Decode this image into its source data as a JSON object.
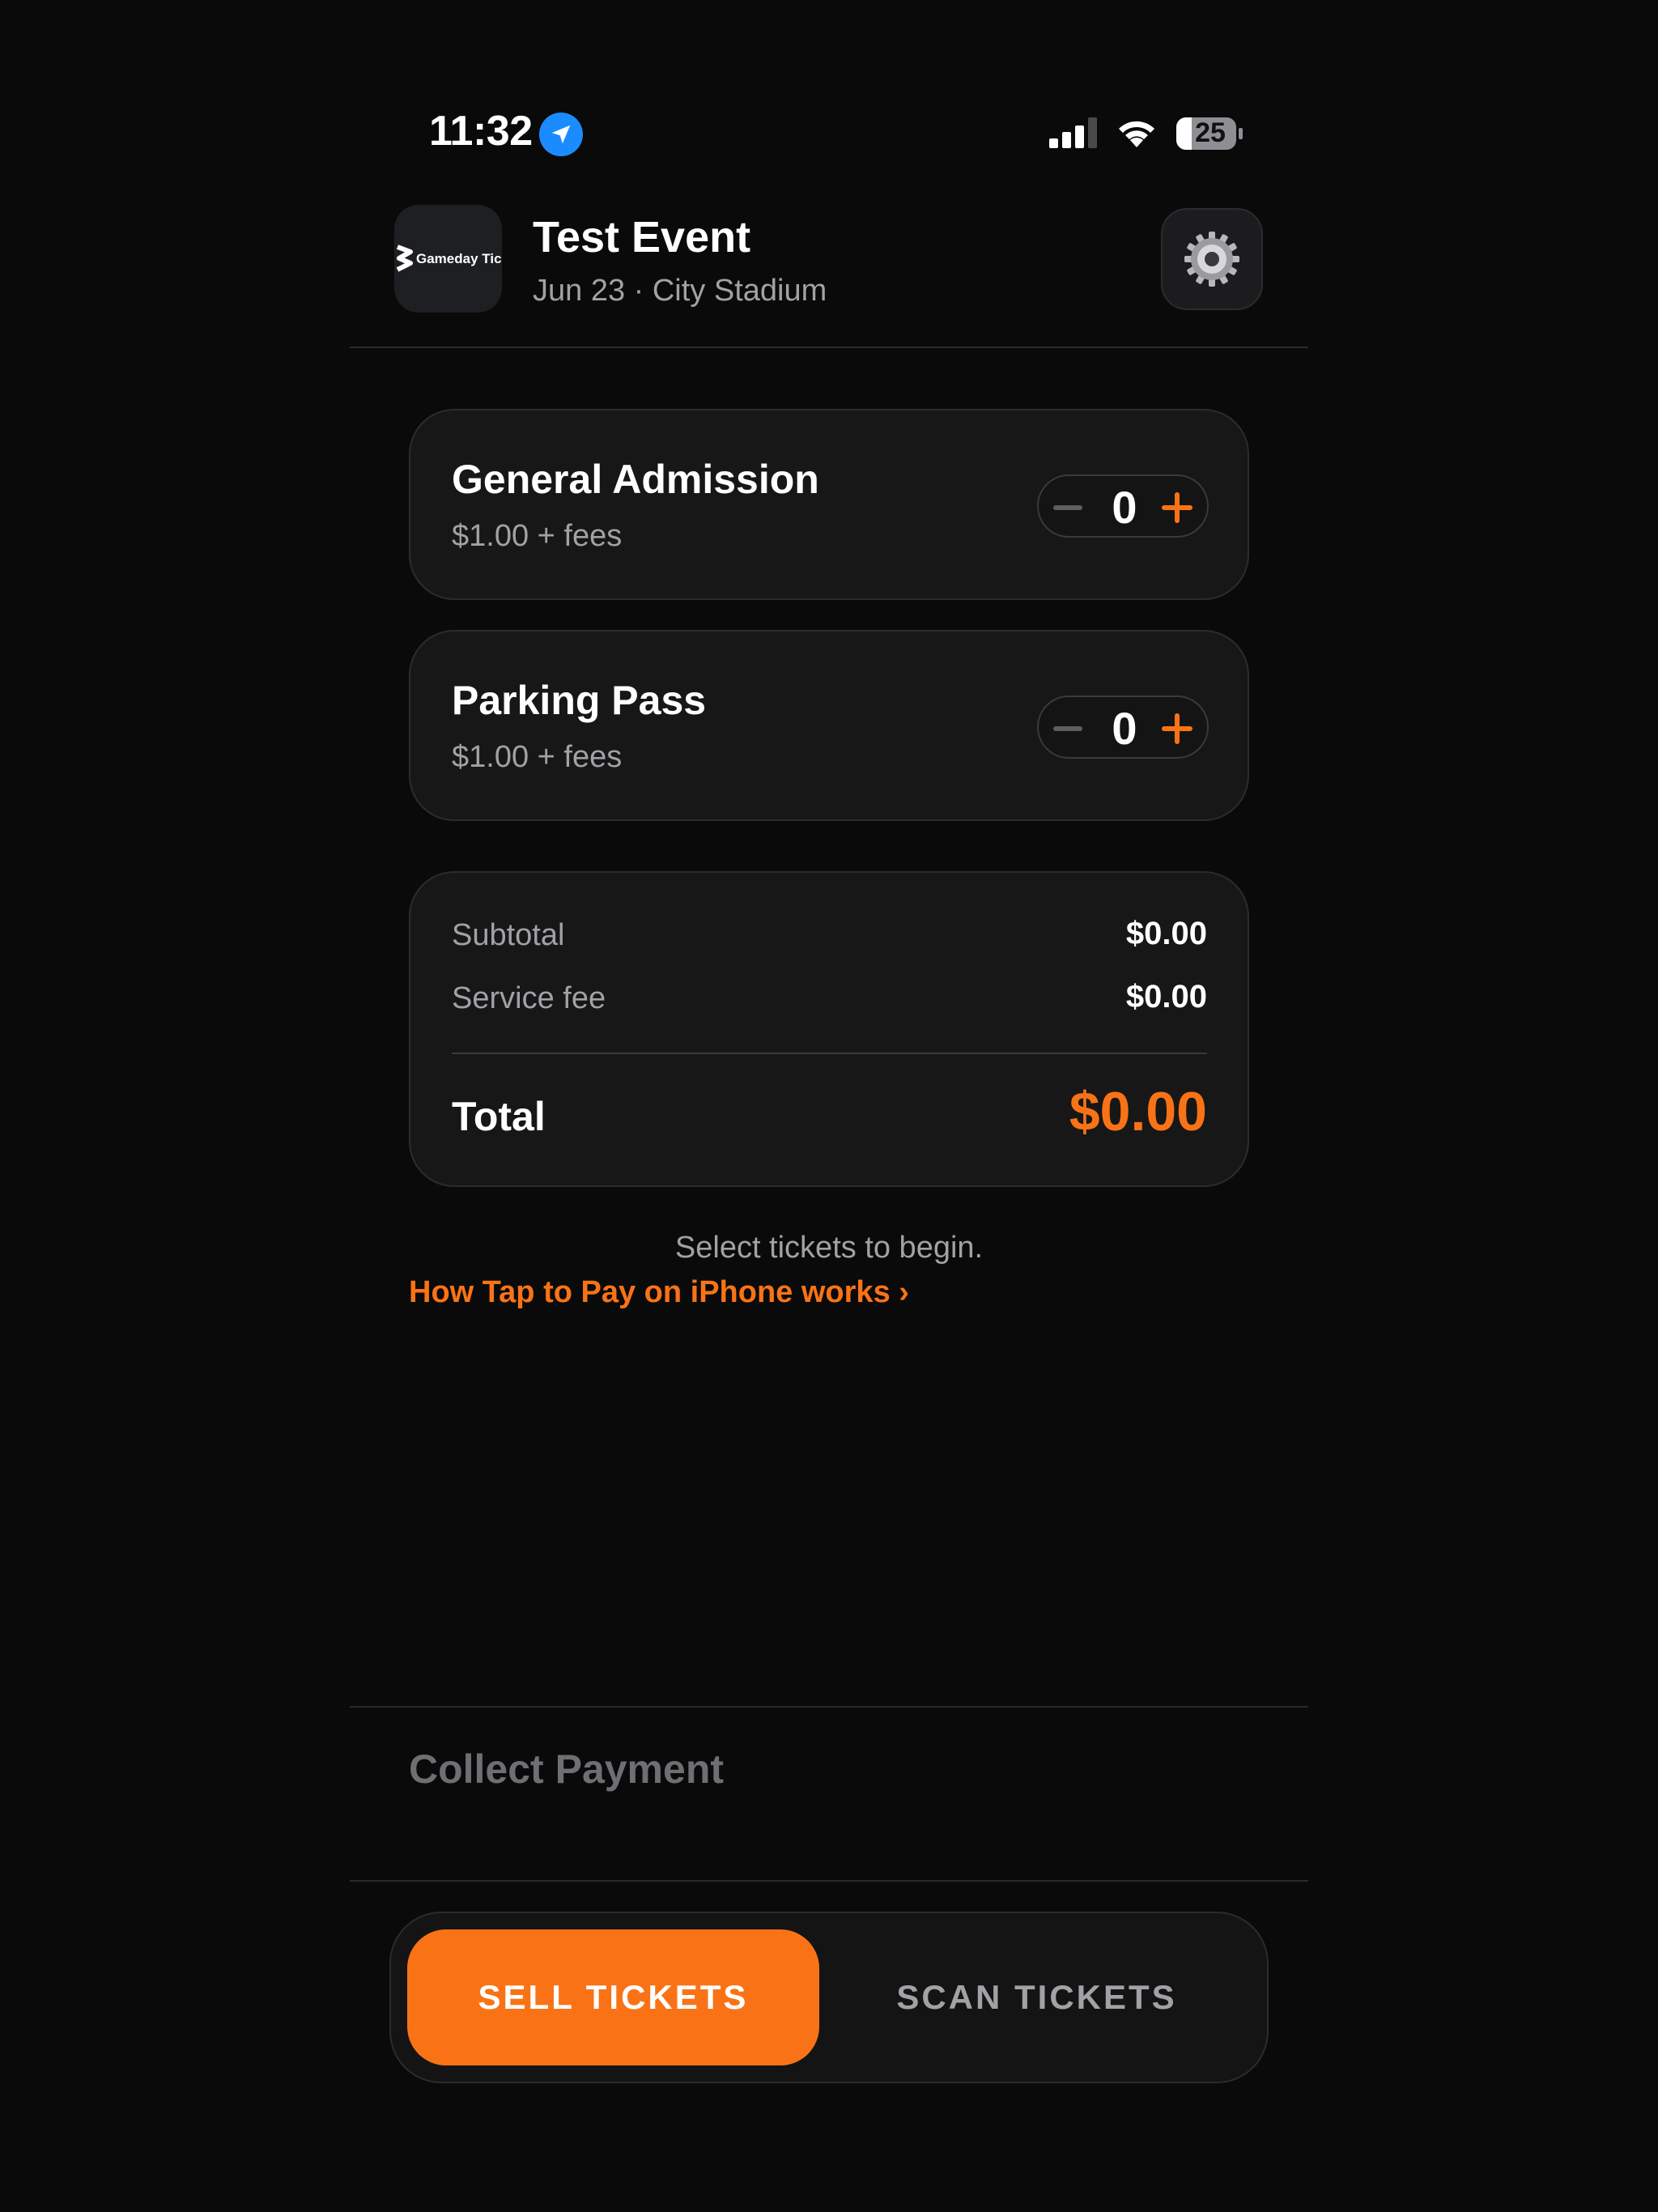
{
  "status_bar": {
    "time": "11:32",
    "battery": "25",
    "icons": [
      "location-arrow-icon",
      "cellular-signal-icon",
      "wifi-icon",
      "battery-icon"
    ]
  },
  "header": {
    "logo_text": "Gameday Tick",
    "title": "Test Event",
    "subtitle": "Jun 23 · City Stadium",
    "settings_icon": "gear-icon"
  },
  "tickets": [
    {
      "name": "General Admission",
      "price": "$1.00 + fees",
      "quantity": "0"
    },
    {
      "name": "Parking Pass",
      "price": "$1.00 + fees",
      "quantity": "0"
    }
  ],
  "summary": {
    "subtotal_label": "Subtotal",
    "subtotal_value": "$0.00",
    "fee_label": "Service fee",
    "fee_value": "$0.00",
    "total_label": "Total",
    "total_value": "$0.00"
  },
  "helper_text": "Select tickets to begin.",
  "howto_link": "How Tap to Pay on iPhone works ›",
  "collect_payment": "Collect Payment",
  "tabs": {
    "sell": "SELL TICKETS",
    "scan": "SCAN TICKETS"
  },
  "colors": {
    "accent": "#f97316",
    "background": "#0a0a0a",
    "card": "#171717",
    "muted_text": "#a1a1a6",
    "location_blue": "#1a8cff"
  }
}
